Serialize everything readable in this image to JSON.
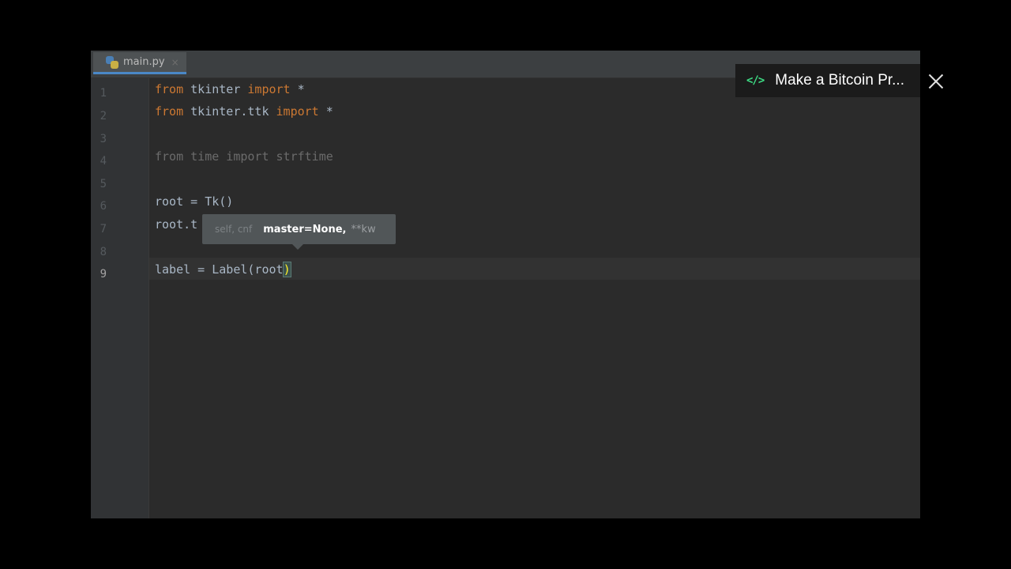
{
  "editor": {
    "tab": {
      "label": "main.py",
      "close": "×"
    },
    "line_numbers": [
      "1",
      "2",
      "3",
      "4",
      "5",
      "6",
      "7",
      "8",
      "9"
    ],
    "code": {
      "l1_kw1": "from",
      "l1_mod": " tkinter ",
      "l1_kw2": "import",
      "l1_rest": " *",
      "l2_kw1": "from",
      "l2_mod": " tkinter.ttk ",
      "l2_kw2": "import",
      "l2_rest": " *",
      "l4": "from time import strftime",
      "l6": "root = Tk()",
      "l7": "root.t",
      "l9_a": "label = Label(root",
      "l9_paren": ")"
    },
    "tooltip": {
      "dim": "self, cnf",
      "bold": "master=None,",
      "rest": "**kw"
    }
  },
  "overlay": {
    "icon": "code-icon",
    "title": "Make a Bitcoin Pr...",
    "accent": "#3ddc84"
  }
}
